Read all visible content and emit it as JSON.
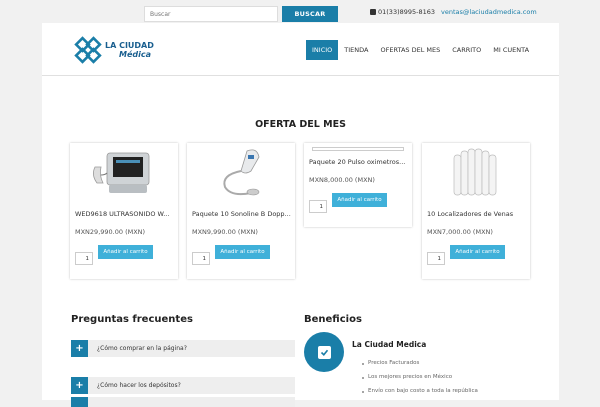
{
  "topbar": {
    "search_placeholder": "Buscar",
    "search_button": "BUSCAR",
    "phone": "01(33)8995-8163",
    "email": "ventas@laciudadmedica.com"
  },
  "logo": {
    "line1": "LA CIUDAD",
    "line2": "Médica"
  },
  "nav": {
    "items": [
      "INICIO",
      "TIENDA",
      "OFERTAS DEL MES",
      "CARRITO",
      "MI CUENTA"
    ],
    "active": "INICIO"
  },
  "section_title": "OFERTA DEL MES",
  "products": [
    {
      "name": "WED9618 ULTRASONIDO W...",
      "price": "MXN29,990.00 (MXN)",
      "qty": "1",
      "button": "Añadir al carrito"
    },
    {
      "name": "Paquete 10 Sonoline B Dopp...",
      "price": "MXN9,990.00 (MXN)",
      "qty": "1",
      "button": "Añadir al carrito"
    },
    {
      "name": "Paquete 20 Pulso oximetros...",
      "price": "MXN8,000.00 (MXN)",
      "qty": "1",
      "button": "Añadir al carrito"
    },
    {
      "name": "10 Localizadores de Venas",
      "price": "MXN7,000.00 (MXN)",
      "qty": "1",
      "button": "Añadir al carrito"
    }
  ],
  "faq": {
    "title": "Preguntas frecuentes",
    "items": [
      "¿Cómo comprar en la página?",
      "¿Cómo hacer los depósitos?"
    ]
  },
  "benefits": {
    "title": "Beneficios",
    "heading": "La Ciudad Medica",
    "items": [
      "Precios Facturados",
      "Los mejores precios en México",
      "Envío con bajo costo a toda la república"
    ]
  },
  "colors": {
    "primary": "#1a7ea8",
    "button": "#3fb0d9"
  }
}
